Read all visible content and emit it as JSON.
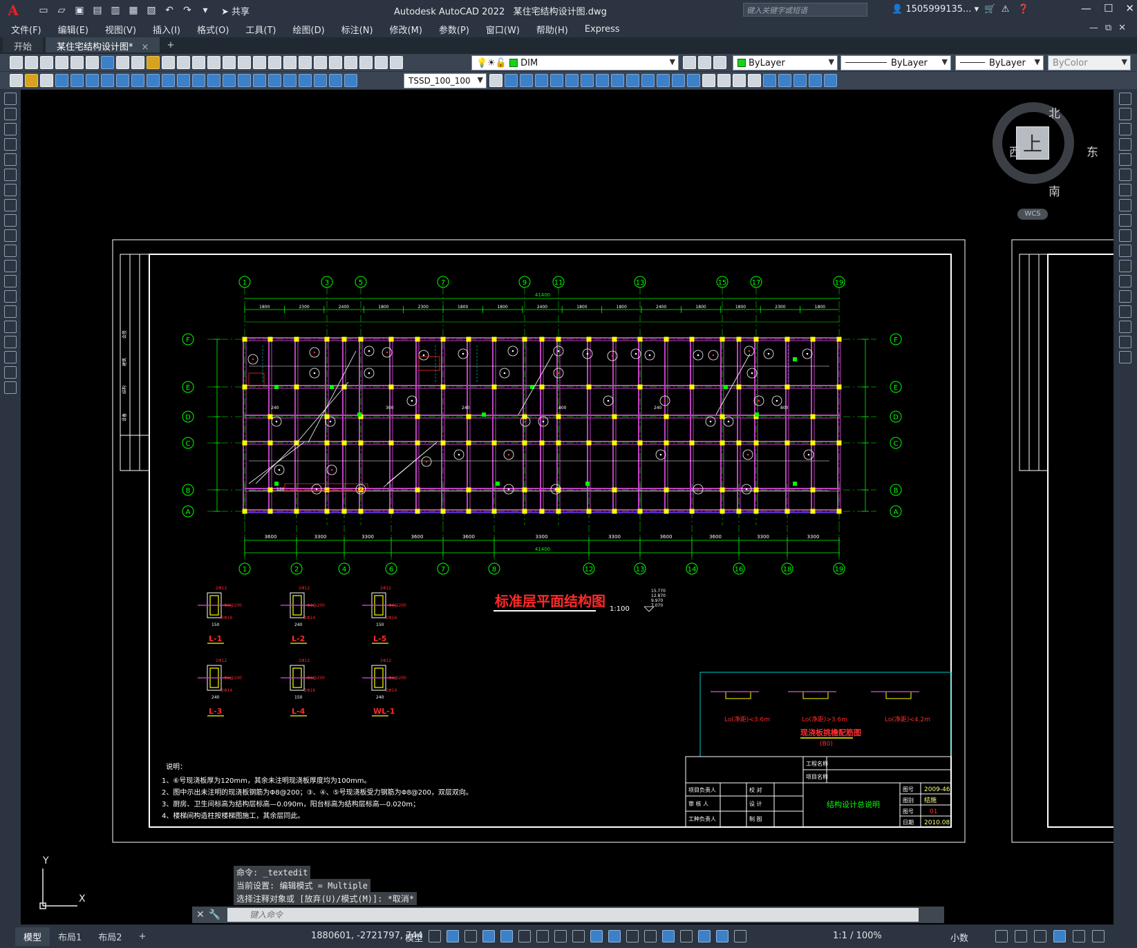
{
  "app": {
    "title": "Autodesk AutoCAD 2022",
    "file": "某住宅结构设计图.dwg",
    "logo_letter": "A",
    "share_label": "共享",
    "search_placeholder": "键入关键字或短语",
    "user": "1505999135... ▾",
    "brand_color": "#e8222b"
  },
  "menu": [
    "文件(F)",
    "编辑(E)",
    "视图(V)",
    "插入(I)",
    "格式(O)",
    "工具(T)",
    "绘图(D)",
    "标注(N)",
    "修改(M)",
    "参数(P)",
    "窗口(W)",
    "帮助(H)",
    "Express"
  ],
  "tabs": {
    "start": "开始",
    "active": "某住宅结构设计图*",
    "close": "×",
    "add": "+"
  },
  "toolbar": {
    "layer": "DIM",
    "color": "ByLayer",
    "linetype": "ByLayer",
    "lineweight": "ByLayer",
    "plotstyle": "ByColor",
    "dimstyle": "TSSD_100_100",
    "layer_color": "#19d119"
  },
  "viewcube": {
    "north": "北",
    "south": "南",
    "east": "东",
    "west": "西",
    "face": "上",
    "wcs": "WCS"
  },
  "ucs": {
    "x": "X",
    "y": "Y"
  },
  "drawing": {
    "title": "标准层平面结构图",
    "scale": "1:100",
    "axes_top": [
      "1",
      "3",
      "5",
      "7",
      "9",
      "11",
      "13",
      "15",
      "17",
      "19"
    ],
    "axes_bottom": [
      "1",
      "2",
      "4",
      "6",
      "7",
      "8",
      "12",
      "13",
      "14",
      "16",
      "18",
      "19"
    ],
    "axes_rows": [
      "F",
      "E",
      "D",
      "C",
      "B",
      "A"
    ],
    "overall_dim": "41400",
    "top_dims": [
      "1800",
      "2300",
      "2400",
      "1800",
      "2300",
      "1800",
      "1800",
      "2400",
      "1800",
      "1800",
      "2400",
      "1800",
      "1800",
      "2300",
      "1800"
    ],
    "bottom_dims": [
      "3600",
      "3300",
      "3300",
      "3600",
      "3600",
      "3300",
      "3300",
      "3600",
      "3600",
      "3300",
      "3300",
      "3600"
    ],
    "elev": [
      "15.770",
      "12.870",
      "9.970",
      "7.070"
    ],
    "sections": [
      "L-1",
      "L-2",
      "L-5",
      "L-3",
      "L-4",
      "WL-1"
    ],
    "section_notes": [
      "2Φ12",
      "Φ6@200",
      "2Φ16",
      "2Φ14"
    ],
    "section_dims": [
      "150",
      "240",
      "300",
      "250",
      "400"
    ],
    "notes_title": "说明：",
    "notes": [
      "1、⑥号现浇板厚为120mm，其余未注明现浇板厚度均为100mm。",
      "2、图中示出未注明的现浇板钢筋为Φ8@200；③、④、⑤号现浇板受力钢筋为Φ8@200，双层双向。",
      "3、厨房、卫生间标高为结构层标高—0.090m，阳台标高为结构层标高—0.020m；",
      "4、楼梯间构造柱按楼梯图施工，其余层同此。"
    ],
    "detail_title": "现浇板挑檐配筋图",
    "detail_sub": "(B0)",
    "detail_labels": [
      "Lo(净距)<3.6m",
      "Lo(净距)>3.6m",
      "Lo(净距)<4.2m"
    ],
    "titleblock": {
      "project_name": "工程名称",
      "project_item": "项目名称",
      "roles": [
        "项目负责人",
        "审 核 人",
        "工种负责人"
      ],
      "roles2": [
        "校 对",
        "设 计",
        "制 图"
      ],
      "drawing_name": "结构设计总说明",
      "fields": [
        "图号",
        "图别",
        "图号",
        "日期"
      ],
      "values": [
        "2009-46",
        "结施",
        "01",
        "2010.08"
      ]
    },
    "left_strip": [
      "会签",
      "建筑",
      "结构",
      "设备"
    ]
  },
  "commands": {
    "history": [
      "命令: _textedit",
      "当前设置: 编辑模式 = Multiple",
      "选择注释对象或 [放弃(U)/模式(M)]: *取消*"
    ],
    "placeholder": "键入命令"
  },
  "status": {
    "layouts": [
      "模型",
      "布局1",
      "布局2"
    ],
    "add": "+",
    "coords": "1880601, -2721797, 744",
    "mode": "模型",
    "scale": "1:1 / 100%",
    "units": "小数"
  }
}
